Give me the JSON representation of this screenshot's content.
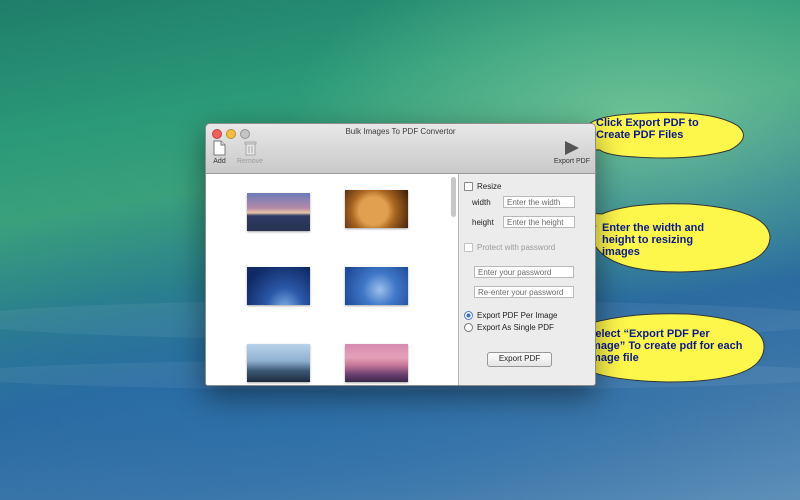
{
  "window": {
    "title": "Bulk Images To PDF Convertor",
    "toolbar": {
      "add_label": "Add",
      "remove_label": "Remove",
      "export_label": "Export PDF"
    }
  },
  "settings": {
    "resize_label": "Resize",
    "width_label": "width",
    "width_placeholder": "Enter the width",
    "height_label": "height",
    "height_placeholder": "Enter the height",
    "password_label": "Protect with password",
    "password_placeholder": "Enter your password",
    "reenter_placeholder": "Re-enter your password",
    "export_per_image_label": "Export PDF Per Image",
    "export_single_label": "Export As Single PDF",
    "export_button_label": "Export  PDF"
  },
  "callouts": {
    "export": "Click Export PDF to Create PDF Files",
    "resize": "Enter the width and height to resizing images",
    "select": "Select “Export PDF Per Image” To create pdf for each image file"
  },
  "colors": {
    "callout_fill": "#fef74b",
    "callout_text": "#0a1a8c",
    "radio_accent": "#2b6bd6"
  },
  "images": [
    {
      "name": "sunset-lake"
    },
    {
      "name": "lion"
    },
    {
      "name": "night-sky"
    },
    {
      "name": "moon-clouds"
    },
    {
      "name": "mountain-haze"
    },
    {
      "name": "mount-fuji-pink"
    }
  ]
}
